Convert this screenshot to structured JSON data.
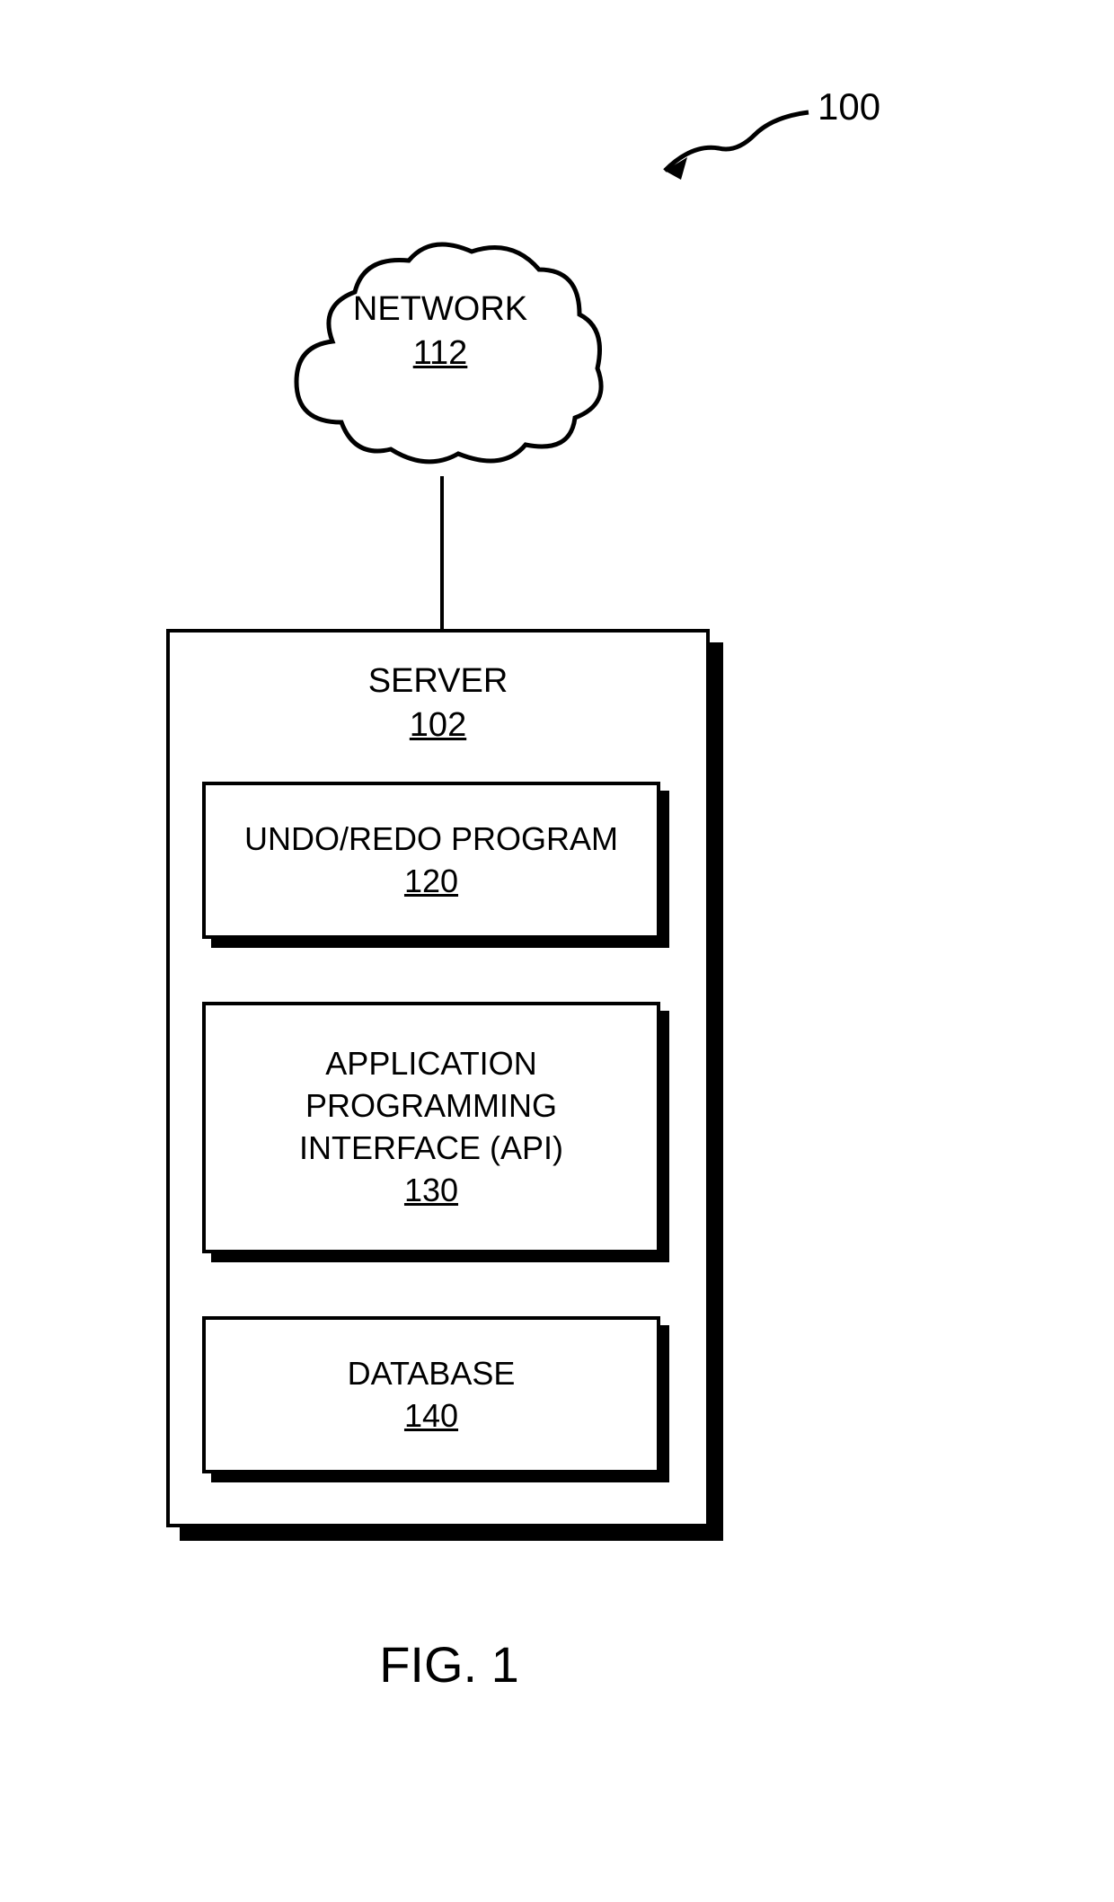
{
  "figure": {
    "reference_number": "100",
    "caption": "FIG. 1"
  },
  "cloud": {
    "label": "NETWORK",
    "number": "112"
  },
  "server": {
    "label": "SERVER",
    "number": "102"
  },
  "boxes": {
    "program": {
      "label": "UNDO/REDO PROGRAM",
      "number": "120"
    },
    "api": {
      "line1": "APPLICATION",
      "line2": "PROGRAMMING",
      "line3": "INTERFACE (API)",
      "number": "130"
    },
    "database": {
      "label": "DATABASE",
      "number": "140"
    }
  }
}
